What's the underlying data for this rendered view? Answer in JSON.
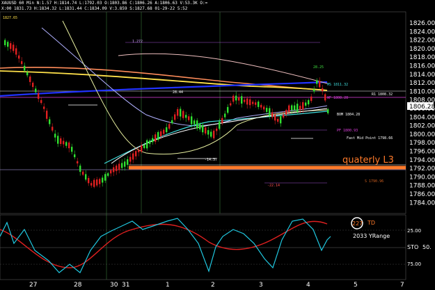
{
  "header": {
    "line1": "XAUUSD 60 Min  N:1.57  H:1814.74  L:1792.03  O:1803.86  C:1806.26  A:1806.63  V:53.3K  O:=",
    "line2": "X:00  1831.73  H:1834.32  L:1831.44  C:1834.09  V:3.859  S:1827.68  01-29-22  5:52"
  },
  "price_axis": {
    "ticks": [
      "1826.00",
      "1824.00",
      "1822.00",
      "1820.00",
      "1818.00",
      "1816.00",
      "1814.00",
      "1812.00",
      "1810.00",
      "1808.00",
      "1806.00",
      "1804.00",
      "1802.00",
      "1800.00",
      "1798.00",
      "1796.00",
      "1794.00",
      "1792.00",
      "1790.00",
      "1788.00",
      "1786.00",
      "1784.00"
    ],
    "current_price": "1806.28",
    "current_color": "#ffffff"
  },
  "time_axis": {
    "ticks": [
      "27",
      "28",
      "30",
      "31",
      "1",
      "2",
      "3",
      "4",
      "5",
      "7"
    ]
  },
  "price_labels": {
    "left_top": "1827.65",
    "level_1": "1.272",
    "mid_1": "28.44",
    "ms": "MS  1811.32",
    "wf": "WF  1808.28",
    "r1": "R1  1808.32",
    "bom": "BOM  1804.28",
    "pf": "PF  1800.93",
    "half": "Fast Mid Point 1798.66",
    "s1": "S  1790.96",
    "peak": "28.25",
    "lower_1": "-14.37",
    "lower_2": "-22.14"
  },
  "annotation": {
    "text": "quaterly L3",
    "color": "#ff7a2a"
  },
  "oscillator": {
    "td_value": "227",
    "td_label": "TD",
    "yrange": "2033 YRange",
    "sto_label": "STO",
    "sto_value": "50.",
    "levels": [
      "25.00",
      "75.00"
    ]
  }
}
